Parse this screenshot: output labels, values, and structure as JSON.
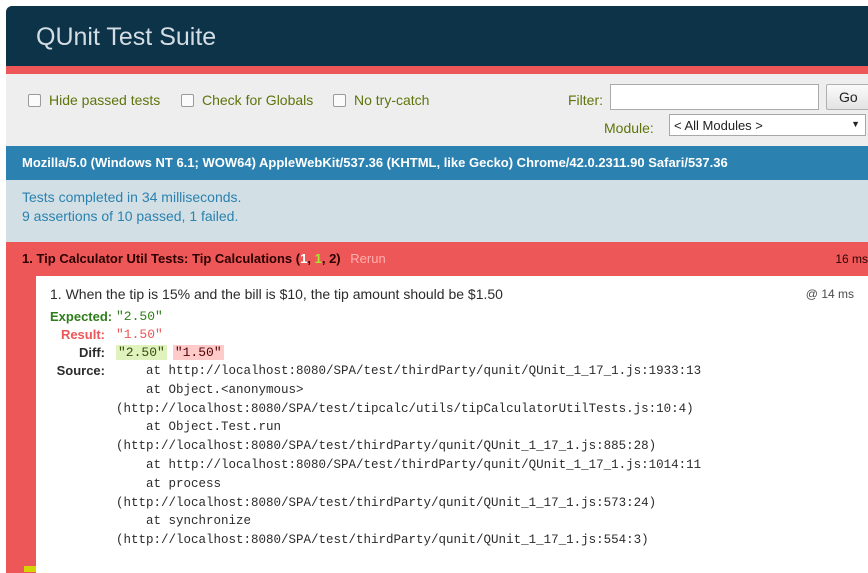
{
  "header": {
    "title": "QUnit Test Suite"
  },
  "toolbar": {
    "hide_passed": "Hide passed tests",
    "check_globals": "Check for Globals",
    "no_try_catch": "No try-catch",
    "filter_label": "Filter:",
    "filter_value": "",
    "go_label": "Go",
    "module_label": "Module:",
    "module_selected": "< All Modules >"
  },
  "user_agent": "Mozilla/5.0 (Windows NT 6.1; WOW64) AppleWebKit/537.36 (KHTML, like Gecko) Chrome/42.0.2311.90 Safari/537.36",
  "results": {
    "line1": "Tests completed in 34 milliseconds.",
    "line2": "9 assertions of 10 passed, 1 failed."
  },
  "test": {
    "name": "1. Tip Calculator Util Tests: Tip Calculations",
    "counts": {
      "open": " (",
      "failed": "1",
      "sep1": ", ",
      "passed": "1",
      "sep2": ", ",
      "total": "2",
      "close": ")"
    },
    "rerun": "Rerun",
    "runtime": "16 ms",
    "assertion": {
      "title": "1. When the tip is 15% and the bill is $10, the tip amount should be $1.50",
      "time": "@ 14 ms",
      "expected_label": "Expected:",
      "expected_value": "\"2.50\"",
      "result_label": "Result:",
      "result_value": "\"1.50\"",
      "diff_label": "Diff:",
      "diff_del": "\"2.50\"",
      "diff_ins": "\"1.50\"",
      "source_label": "Source:",
      "source": "    at http://localhost:8080/SPA/test/thirdParty/qunit/QUnit_1_17_1.js:1933:13\n    at Object.<anonymous>\n(http://localhost:8080/SPA/test/tipcalc/utils/tipCalculatorUtilTests.js:10:4)\n    at Object.Test.run\n(http://localhost:8080/SPA/test/thirdParty/qunit/QUnit_1_17_1.js:885:28)\n    at http://localhost:8080/SPA/test/thirdParty/qunit/QUnit_1_17_1.js:1014:11\n    at process\n(http://localhost:8080/SPA/test/thirdParty/qunit/QUnit_1_17_1.js:573:24)\n    at synchronize\n(http://localhost:8080/SPA/test/thirdParty/qunit/QUnit_1_17_1.js:554:3)"
    }
  },
  "colors": {
    "header_bg": "#0d3349",
    "fail_red": "#ee5757",
    "useragent_blue": "#2b81af",
    "results_bg": "#d2e0e6",
    "pass_green": "#5e740b"
  }
}
